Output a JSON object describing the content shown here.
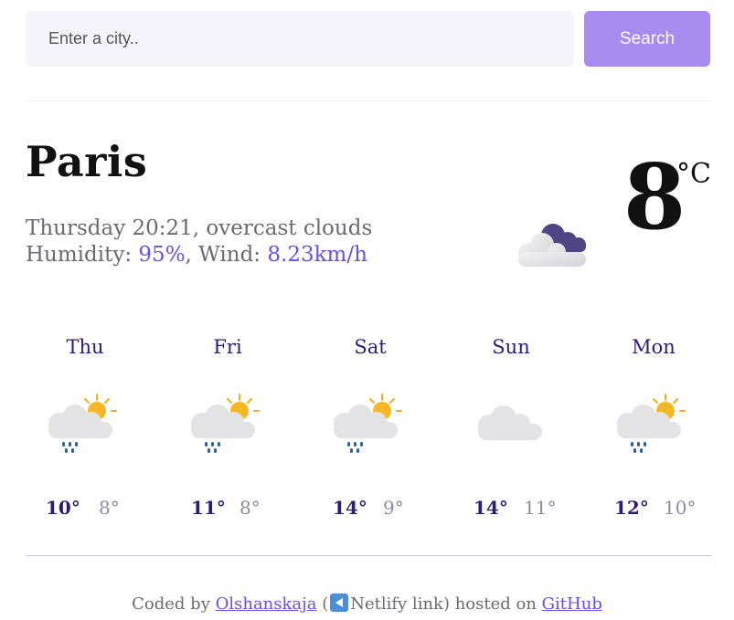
{
  "search": {
    "placeholder": "Enter a city..",
    "button_label": "Search"
  },
  "current": {
    "city": "Paris",
    "day_time": "Thursday 20:21",
    "description": "overcast clouds",
    "humidity_label": "Humidity:",
    "humidity": "95%",
    "wind_label": "Wind:",
    "wind": "8.23km/h",
    "temperature": "8",
    "unit": "°C",
    "icon": "overcast-clouds-icon"
  },
  "forecast": [
    {
      "day": "Thu",
      "max": "10°",
      "min": "8°",
      "icon": "sun-cloud-rain-icon"
    },
    {
      "day": "Fri",
      "max": "11°",
      "min": "8°",
      "icon": "sun-cloud-rain-icon"
    },
    {
      "day": "Sat",
      "max": "14°",
      "min": "9°",
      "icon": "sun-cloud-rain-icon"
    },
    {
      "day": "Sun",
      "max": "14°",
      "min": "11°",
      "icon": "cloud-icon"
    },
    {
      "day": "Mon",
      "max": "12°",
      "min": "10°",
      "icon": "sun-cloud-rain-icon"
    }
  ],
  "footer": {
    "coded_by": "Coded by",
    "author": "Olshanskaja",
    "paren_open": "(",
    "netlify": "Netlify link",
    "hosted_on": ") hosted on",
    "github": "GitHub"
  },
  "colors": {
    "accent": "#a78bee",
    "highlight": "#6a4fe0",
    "forecast_text": "#2a1d78",
    "muted": "#8e8aa4"
  }
}
